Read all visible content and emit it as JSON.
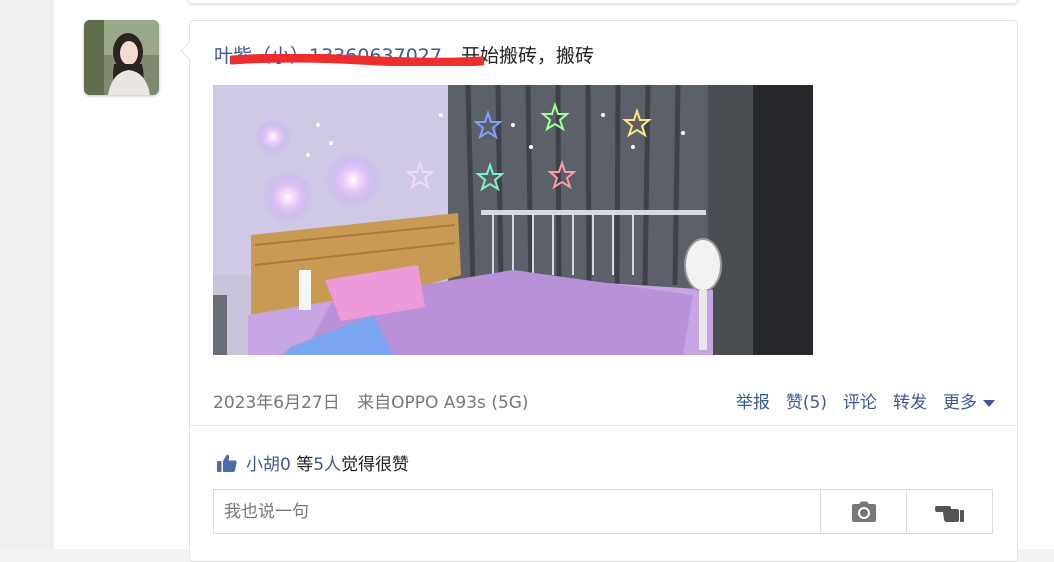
{
  "post": {
    "author": "叶紫（小）13360637027",
    "content": "，开始搬砖，搬砖",
    "date": "2023年6月27日",
    "source": "来自OPPO A93s (5G)"
  },
  "actions": {
    "report": "举报",
    "like": "赞(5)",
    "comment": "评论",
    "forward": "转发",
    "more": "更多"
  },
  "likes": {
    "liker": "小胡0",
    "deng": "等",
    "count": "5人",
    "suffix": "觉得很赞"
  },
  "comment": {
    "placeholder": "我也说一句"
  },
  "icons": {
    "camera": "camera-icon",
    "like": "thumbs-up-icon",
    "finger": "pointing-hand-icon"
  },
  "colors": {
    "link": "#3b5998",
    "redact": "#ee2d2d"
  }
}
